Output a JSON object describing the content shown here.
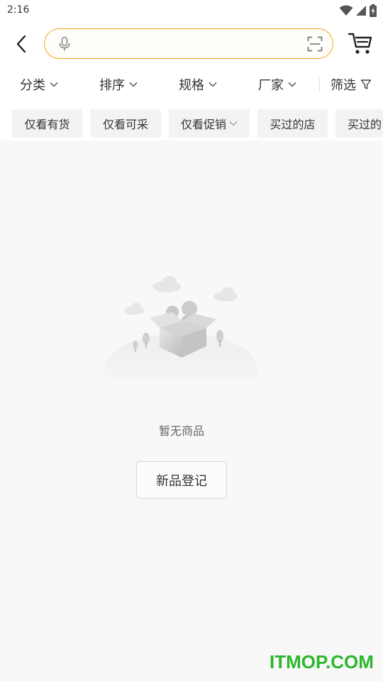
{
  "status_bar": {
    "time": "2:16",
    "icons": [
      "wifi-icon",
      "signal-icon",
      "battery-charging-icon"
    ]
  },
  "header": {
    "back_icon": "chevron-left-icon",
    "search": {
      "placeholder": "",
      "value": "",
      "icons": [
        "mic-icon",
        "scan-icon"
      ]
    },
    "cart_icon": "cart-icon",
    "accent_color": "#f5a623"
  },
  "filters": [
    {
      "label": "分类",
      "icon": "chevron-down-icon"
    },
    {
      "label": "排序",
      "icon": "chevron-down-icon"
    },
    {
      "label": "规格",
      "icon": "chevron-down-icon"
    },
    {
      "label": "厂家",
      "icon": "chevron-down-icon"
    },
    {
      "label": "筛选",
      "icon": "filter-funnel-icon"
    }
  ],
  "chips": [
    {
      "label": "仅看有货"
    },
    {
      "label": "仅看可采"
    },
    {
      "label": "仅看促销",
      "icon": "chevron-down-icon"
    },
    {
      "label": "买过的店"
    },
    {
      "label": "买过的"
    }
  ],
  "empty_state": {
    "illustration": "empty-box-people-illustration",
    "message": "暂无商品",
    "button_label": "新品登记"
  },
  "watermark": {
    "text": "ITMOP.COM",
    "color": "#2db72d"
  }
}
